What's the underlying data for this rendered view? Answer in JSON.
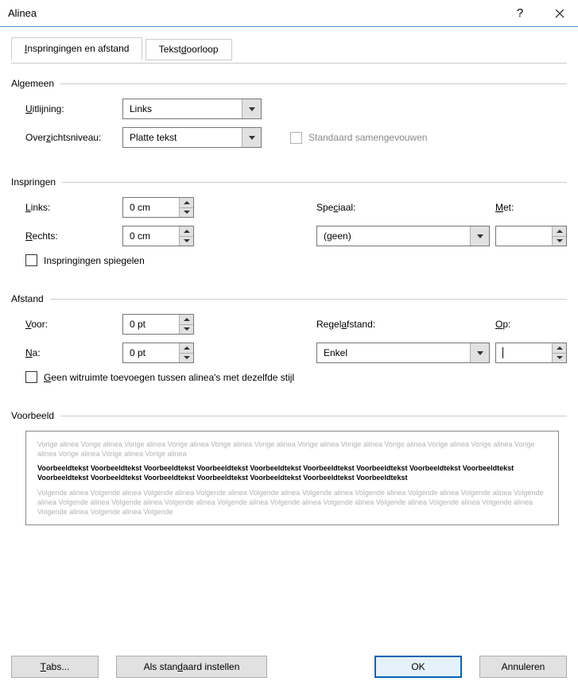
{
  "window": {
    "title": "Alinea"
  },
  "tabs": {
    "active": "Inspringingen en afstand",
    "inactive": "Tekstdoorloop"
  },
  "algemeen": {
    "title": "Algemeen",
    "uitlijning_label": "Uitlijning:",
    "uitlijning_value": "Links",
    "overzichtsniveau_label": "Overzichtsniveau:",
    "overzichtsniveau_value": "Platte tekst",
    "standaard_samengevouwen": "Standaard samengevouwen"
  },
  "inspringen": {
    "title": "Inspringen",
    "links_label": "Links:",
    "links_value": "0 cm",
    "rechts_label": "Rechts:",
    "rechts_value": "0 cm",
    "speciaal_label": "Speciaal:",
    "speciaal_value": "(geen)",
    "met_label": "Met:",
    "met_value": "",
    "spiegelen": "Inspringingen spiegelen"
  },
  "afstand": {
    "title": "Afstand",
    "voor_label": "Voor:",
    "voor_value": "0 pt",
    "na_label": "Na:",
    "na_value": "0 pt",
    "regelafstand_label": "Regelafstand:",
    "regelafstand_value": "Enkel",
    "op_label": "Op:",
    "op_value": "",
    "geen_witruimte": "Geen witruimte toevoegen tussen alinea's met dezelfde stijl"
  },
  "voorbeeld": {
    "title": "Voorbeeld",
    "prev": "Vorige alinea Vorige alinea Vorige alinea Vorige alinea Vorige alinea Vorige alinea Vorige alinea Vorige alinea Vorige alinea Vorige alinea Vorige alinea Vorige alinea Vorige alinea Vorige alinea Vorige alinea",
    "sample": "Voorbeeldtekst Voorbeeldtekst Voorbeeldtekst Voorbeeldtekst Voorbeeldtekst Voorbeeldtekst Voorbeeldtekst Voorbeeldtekst Voorbeeldtekst Voorbeeldtekst Voorbeeldtekst Voorbeeldtekst Voorbeeldtekst Voorbeeldtekst Voorbeeldtekst Voorbeeldtekst",
    "next": "Volgende alinea Volgende alinea Volgende alinea Volgende alinea Volgende alinea Volgende alinea Volgende alinea Volgende alinea Volgende alinea Volgende alinea Volgende alinea Volgende alinea Volgende alinea Volgende alinea Volgende alinea Volgende alinea Volgende alinea Volgende alinea Volgende alinea Volgende alinea Volgende alinea Volgende"
  },
  "buttons": {
    "tabs": "Tabs...",
    "standaard": "Als standaard instellen",
    "ok": "OK",
    "annuleren": "Annuleren"
  }
}
